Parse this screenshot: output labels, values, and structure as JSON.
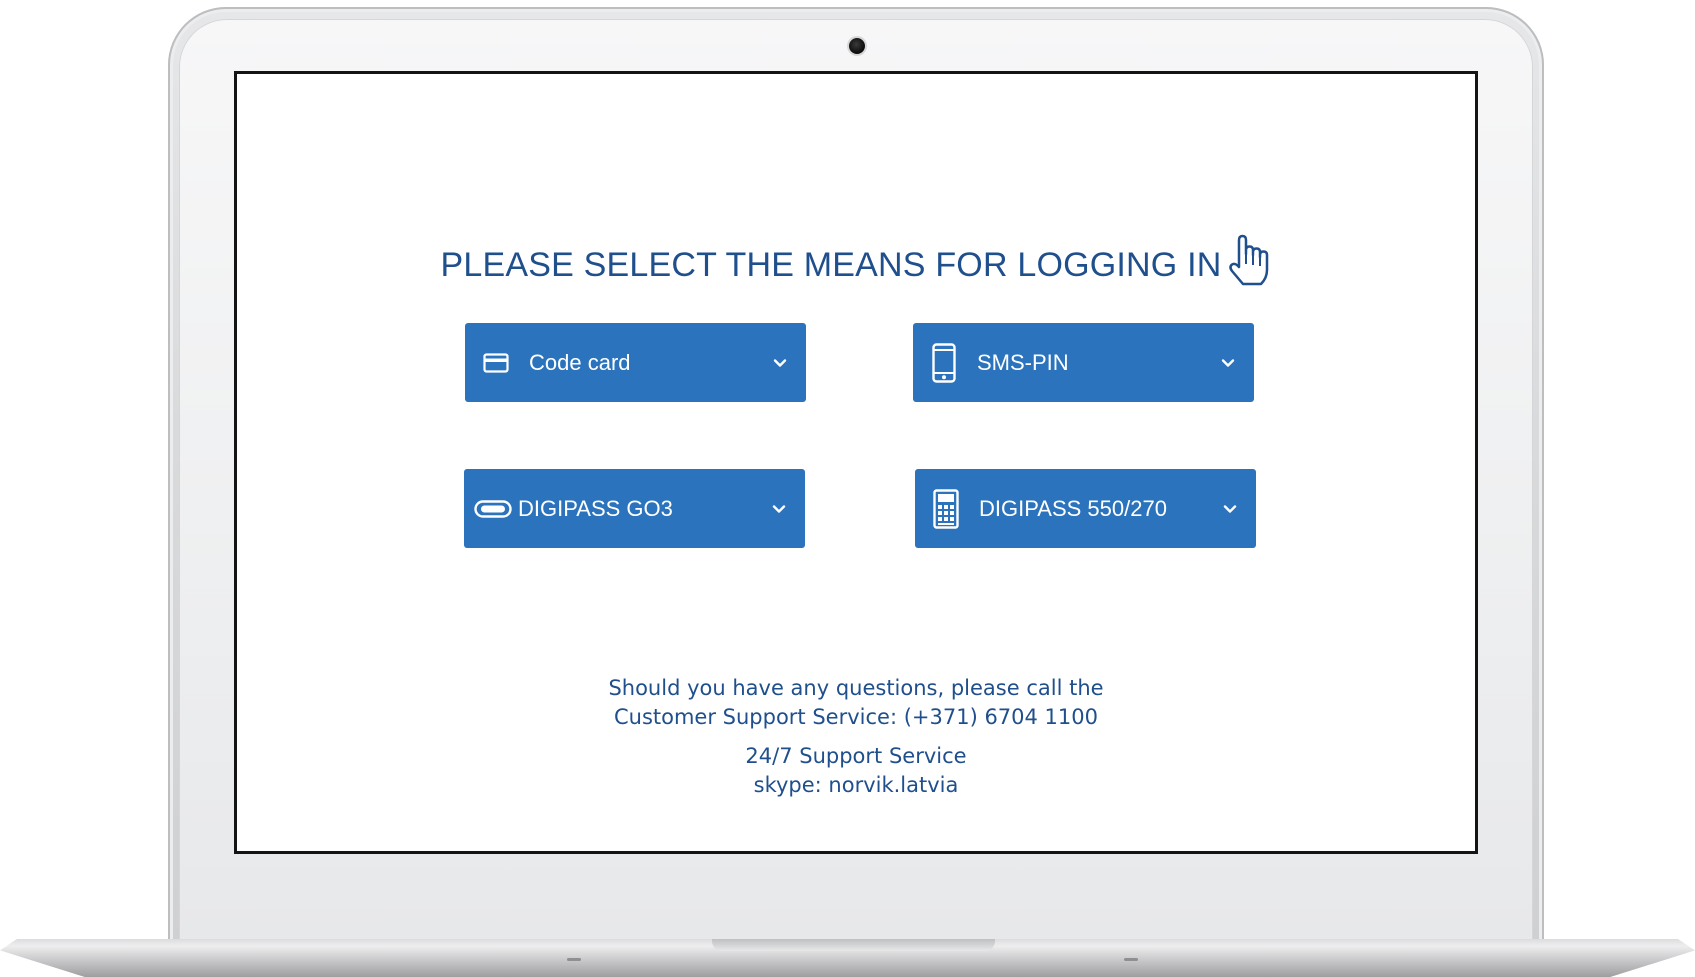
{
  "heading": {
    "text": "PLEASE SELECT THE MEANS FOR LOGGING IN",
    "icon": "hand-pointer-icon"
  },
  "login_options": [
    {
      "label": "Code card",
      "icon": "credit-card-icon"
    },
    {
      "label": "SMS-PIN",
      "icon": "mobile-phone-icon"
    },
    {
      "label": "DIGIPASS GO3",
      "icon": "token-device-icon"
    },
    {
      "label": "DIGIPASS 550/270",
      "icon": "calculator-icon"
    }
  ],
  "support": {
    "line1": "Should you have any questions, please call the",
    "line2": "Customer Support Service: (+371) 6704 1100",
    "line3": "24/7 Support Service",
    "line4": "skype: norvik.latvia"
  },
  "colors": {
    "accent": "#2b74bd",
    "text": "#1f4f8c"
  }
}
